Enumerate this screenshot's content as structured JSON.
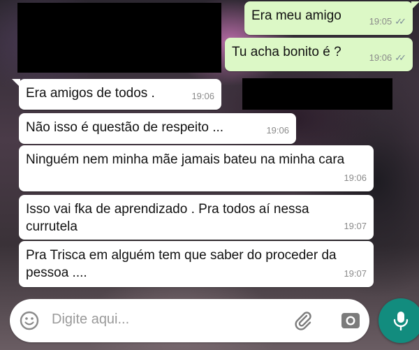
{
  "messages": [
    {
      "direction": "outgoing",
      "text": "Era meu amigo",
      "time": "19:05",
      "status": "read-double-check-icon"
    },
    {
      "direction": "outgoing",
      "text": "Tu acha bonito é ?",
      "time": "19:06",
      "status": "read-double-check-icon"
    },
    {
      "direction": "incoming",
      "text": "Era amigos de todos .",
      "time": "19:06"
    },
    {
      "direction": "incoming",
      "text": "Não isso é questão de respeito ...",
      "time": "19:06"
    },
    {
      "direction": "incoming",
      "text": "Ninguém nem minha mãe jamais bateu na minha cara",
      "time": "19:06"
    },
    {
      "direction": "incoming",
      "text": "Isso vai fka de aprendizado . Pra todos aí nessa currutela",
      "time": "19:07"
    },
    {
      "direction": "incoming",
      "text": "Pra Trisca em alguém tem que saber do proceder da pessoa  ....",
      "time": "19:07"
    }
  ],
  "composer": {
    "placeholder": "Digite aqui...",
    "icons": [
      "emoji-icon",
      "paperclip-icon",
      "camera-icon",
      "microphone-icon"
    ]
  },
  "colors": {
    "outgoing_bubble": "#dcf8c6",
    "incoming_bubble": "#ffffff",
    "mic_button": "#128c7e"
  }
}
